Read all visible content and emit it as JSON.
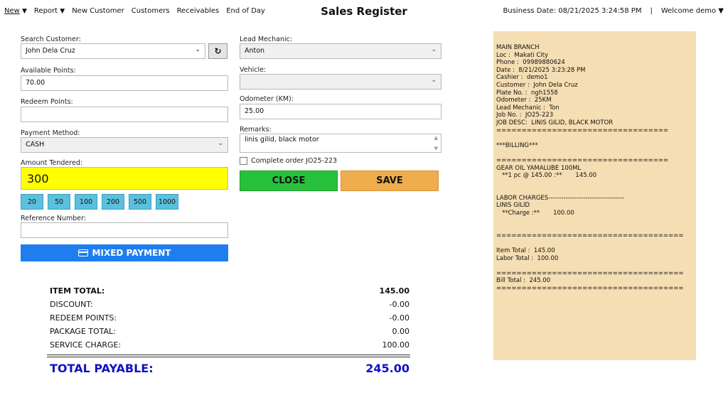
{
  "menu": {
    "new": "New",
    "report": "Report",
    "new_customer": "New Customer",
    "customers": "Customers",
    "receivables": "Receivables",
    "end_of_day": "End of Day"
  },
  "title": "Sales Register",
  "business_date": "Business Date: 08/21/2025 3:24:58 PM",
  "separator": "|",
  "welcome": "Welcome demo",
  "form": {
    "search_customer_label": "Search Customer:",
    "search_customer_value": "John Dela Cruz",
    "available_points_label": "Available Points:",
    "available_points_value": "70.00",
    "redeem_points_label": "Redeem Points:",
    "redeem_points_value": "",
    "payment_method_label": "Payment Method:",
    "payment_method_value": "CASH",
    "amount_tendered_label": "Amount Tendered:",
    "amount_tendered_value": "300",
    "quick_amounts": [
      "20",
      "50",
      "100",
      "200",
      "500",
      "1000"
    ],
    "reference_number_label": "Reference Number:",
    "reference_number_value": "",
    "mixed_payment_label": "MIXED PAYMENT",
    "lead_mechanic_label": "Lead Mechanic:",
    "lead_mechanic_value": "Anton",
    "vehicle_label": "Vehicle:",
    "vehicle_value": "",
    "odometer_label": "Odometer (KM):",
    "odometer_value": "25.00",
    "remarks_label": "Remarks:",
    "remarks_value": "linis gilid, black motor",
    "complete_order_label": "Complete order JO25-223",
    "close_label": "CLOSE",
    "save_label": "SAVE"
  },
  "totals": {
    "item_total_label": "ITEM TOTAL:",
    "item_total_value": "145.00",
    "discount_label": "DISCOUNT:",
    "discount_value": "-0.00",
    "redeem_points_label": "REDEEM POINTS:",
    "redeem_points_value": "-0.00",
    "package_total_label": "PACKAGE TOTAL:",
    "package_total_value": "0.00",
    "service_charge_label": "SERVICE CHARGE:",
    "service_charge_value": "100.00",
    "total_payable_label": "TOTAL PAYABLE:",
    "total_payable_value": "245.00"
  },
  "receipt": {
    "lines": [
      "MAIN BRANCH",
      "Loc :  Makati City",
      "Phone :  09989880624",
      "Date :  8/21/2025 3:23:28 PM",
      "Cashier :  demo1",
      "Customer :  John Dela Cruz",
      "Plate No. :  ngh1558",
      "Odometer :  25KM",
      "Lead Mechanic :  Ton",
      "Job No. :  JO25-223",
      "JOB DESC:  LINIS GILID, BLACK MOTOR",
      "==================================",
      "",
      "***BILLING***",
      "",
      "==================================",
      "GEAR OIL YAMALUBE 100ML",
      "   **1 pc @ 145.00 :**       145.00",
      "",
      "",
      "LABOR CHARGES-----------------------------------",
      "LINIS GILID",
      "   **Charge :**       100.00",
      "",
      "",
      "=====================================",
      "",
      "Item Total :  145.00",
      "Labor Total :  100.00",
      "",
      "=====================================",
      "Bill Total :  245.00",
      "====================================="
    ]
  },
  "colors": {
    "amount_bg": "#ffff00",
    "quick_bg": "#5bc0de",
    "mixed_bg": "#1e7ef0",
    "close_bg": "#27c13b",
    "save_bg": "#f0ad4e",
    "payable_color": "#1010c8",
    "receipt_bg": "#f5deb3"
  }
}
